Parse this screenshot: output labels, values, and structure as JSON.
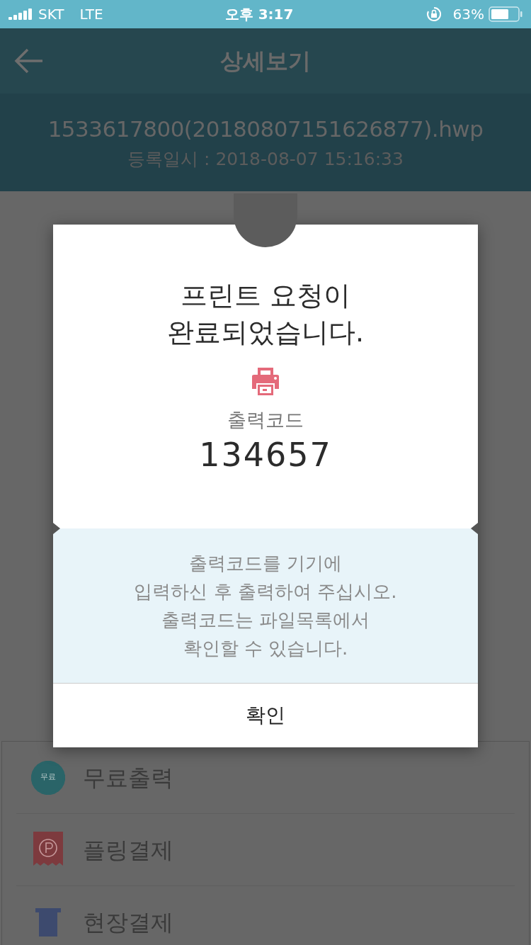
{
  "status_bar": {
    "carrier": "SKT",
    "network": "LTE",
    "time": "오후 3:17",
    "battery_percent": "63%"
  },
  "header": {
    "title": "상세보기"
  },
  "file": {
    "name": "1533617800(20180807151626877).hwp",
    "registered": "등록일시 : 2018-08-07 15:16:33"
  },
  "payment_options": [
    {
      "kind": "free",
      "badge": "무료",
      "label": "무료출력"
    },
    {
      "kind": "pling",
      "label": "플링결제"
    },
    {
      "kind": "onsite",
      "label": "현장결제"
    }
  ],
  "dialog": {
    "title_lines": [
      "프린트 요청이",
      "완료되었습니다."
    ],
    "code_label": "출력코드",
    "code": "134657",
    "message_lines": [
      "출력코드를 기기에",
      "입력하신 후 출력하여 주십시오.",
      "출력코드는 파일목록에서",
      "확인할 수 있습니다."
    ],
    "confirm": "확인"
  }
}
